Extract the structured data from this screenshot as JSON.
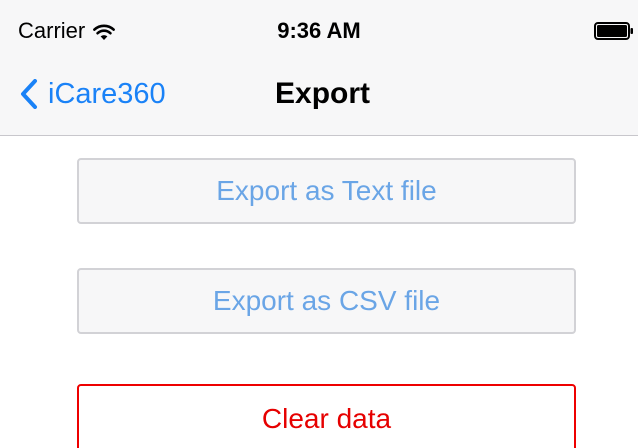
{
  "status_bar": {
    "carrier": "Carrier",
    "time": "9:36 AM",
    "wifi_icon": "wifi-icon",
    "battery_icon": "battery-full-icon"
  },
  "nav_bar": {
    "back_label": "iCare360",
    "back_icon": "chevron-left-icon",
    "title": "Export"
  },
  "actions": {
    "export_text_label": "Export as Text file",
    "export_csv_label": "Export as CSV file",
    "clear_data_label": "Clear data"
  },
  "colors": {
    "accent_blue": "#1a82f7",
    "button_text_blue": "#6aa5e6",
    "destructive_red": "#e60000",
    "bar_background": "#f7f7f8"
  }
}
